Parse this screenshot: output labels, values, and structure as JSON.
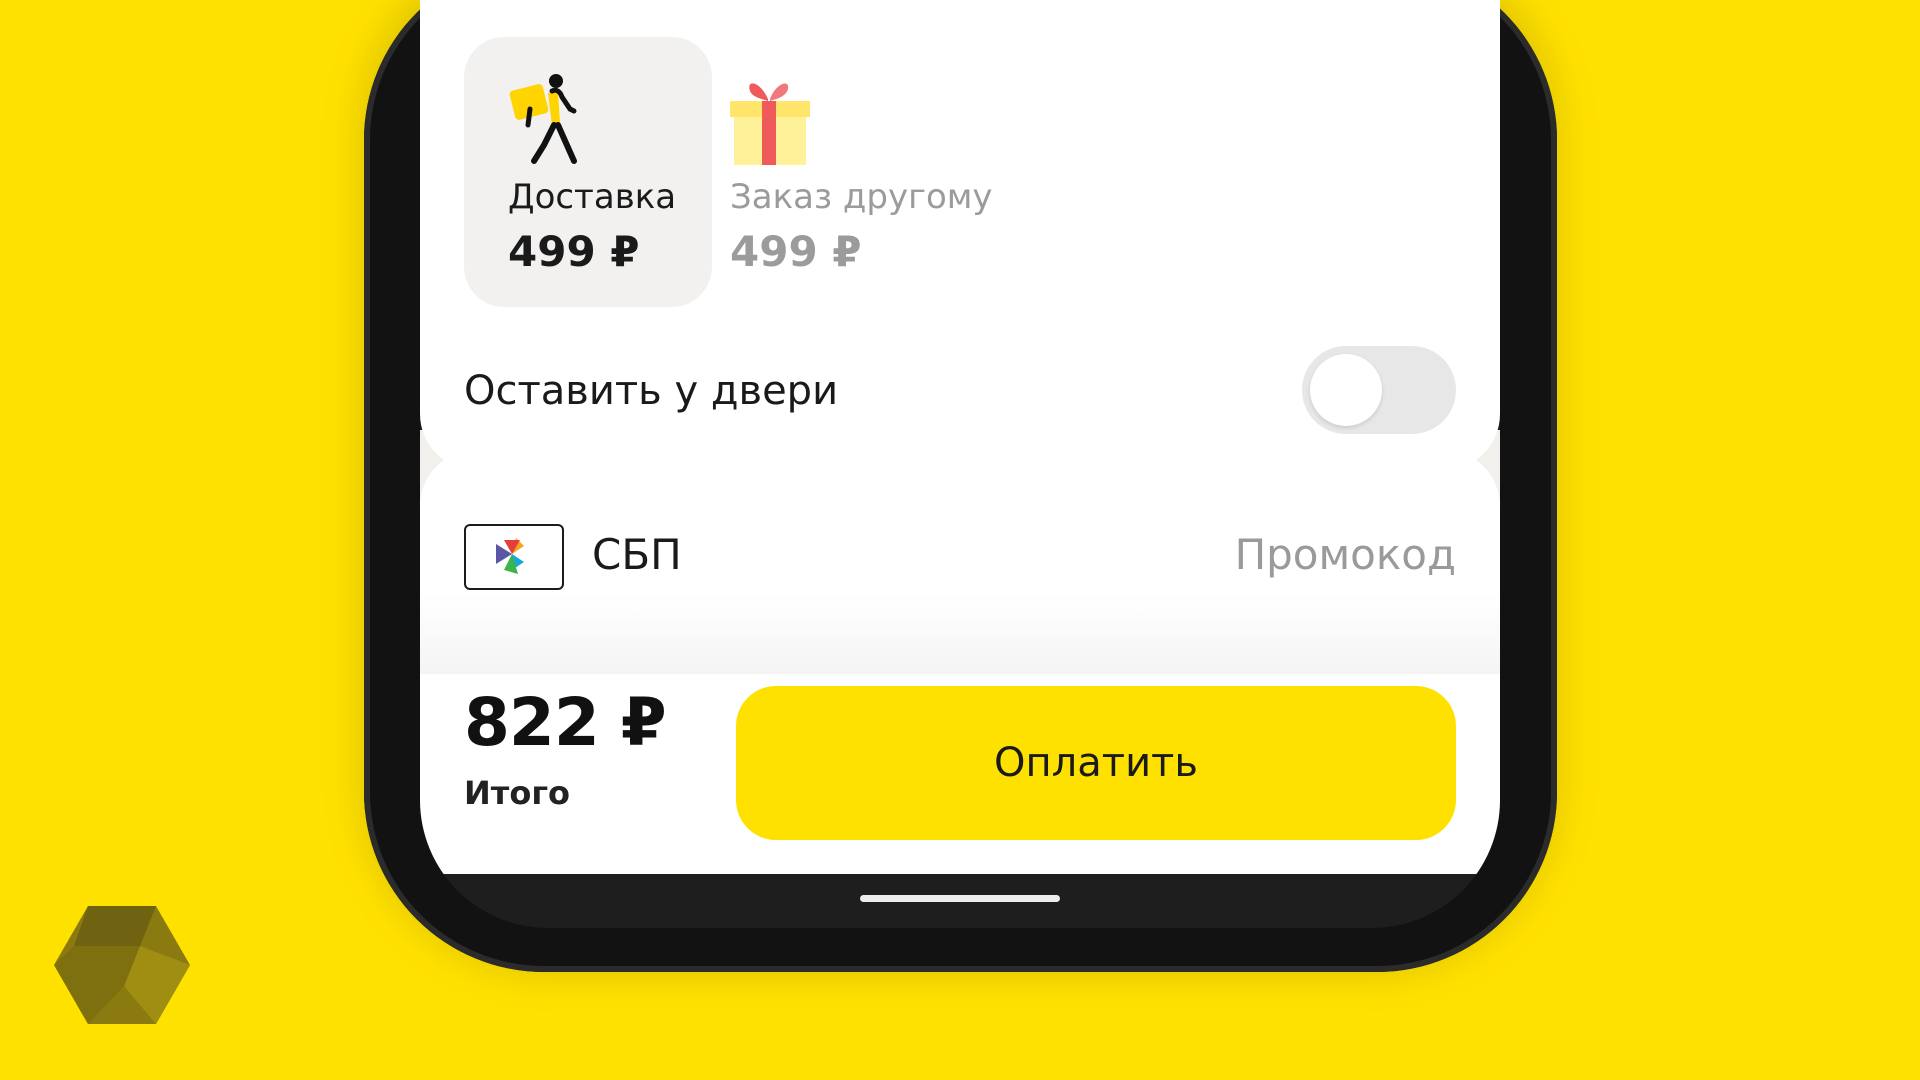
{
  "delivery_options": [
    {
      "title": "Доставка",
      "price": "499 ₽",
      "icon": "courier-icon",
      "selected": true
    },
    {
      "title": "Заказ другому",
      "price": "499 ₽",
      "icon": "gift-icon",
      "selected": false
    }
  ],
  "leave_at_door": {
    "label": "Оставить у двери",
    "enabled": false
  },
  "payment": {
    "method": "СБП",
    "method_icon": "sbp-logo-icon",
    "promo_label": "Промокод"
  },
  "total": {
    "amount": "822 ₽",
    "label": "Итого"
  },
  "pay_button": {
    "label": "Оплатить"
  },
  "colors": {
    "brand_yellow": "#ffe100",
    "accent_red": "#ef5b5b"
  }
}
